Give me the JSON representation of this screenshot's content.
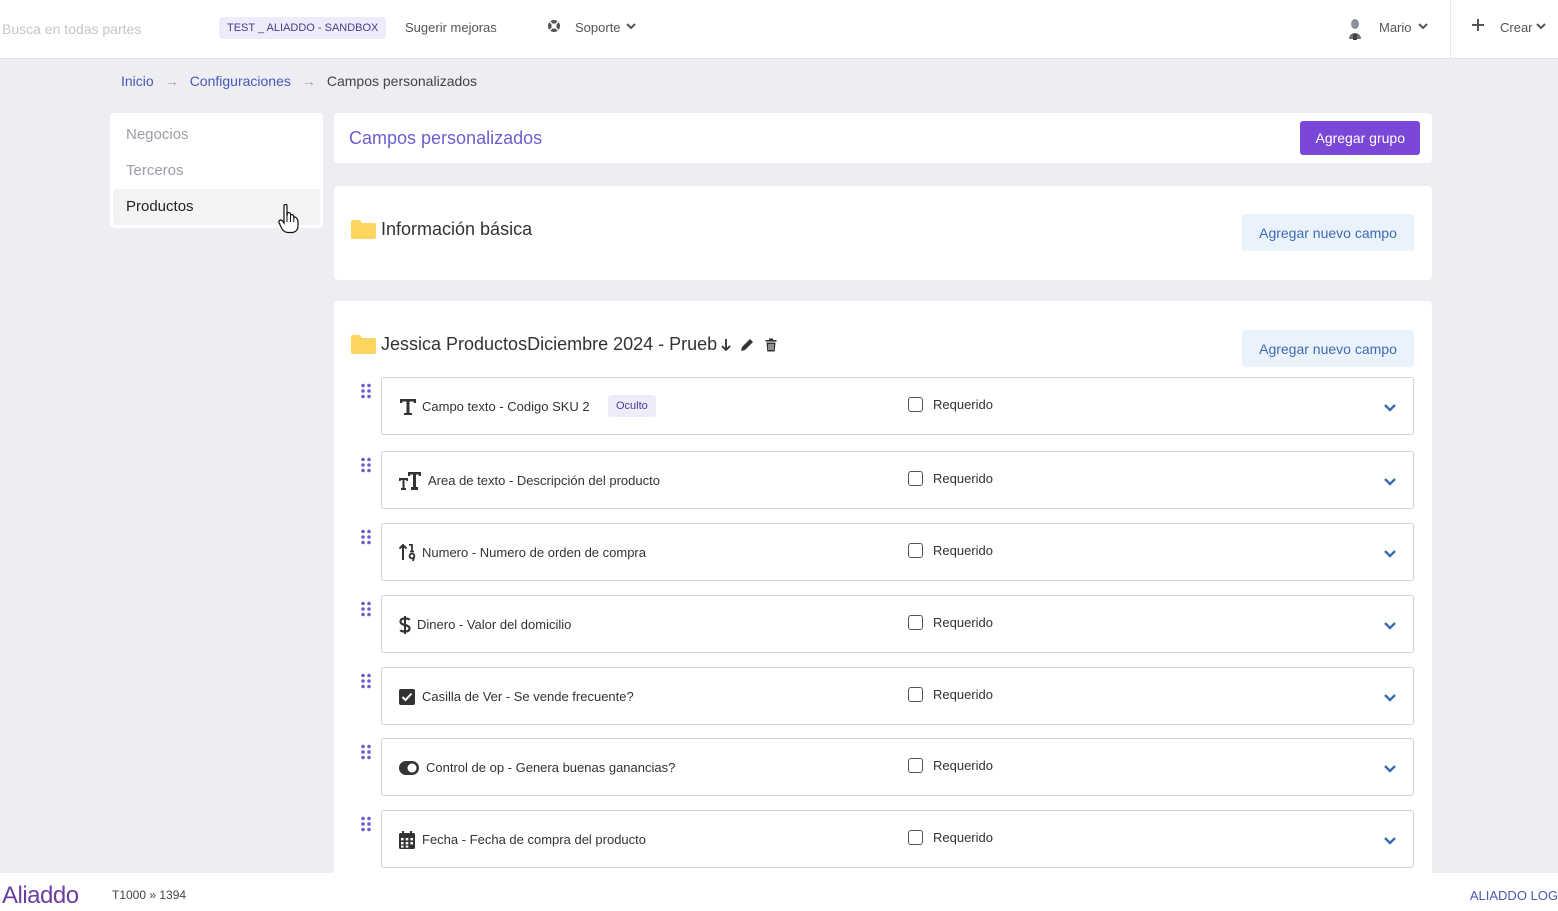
{
  "topbar": {
    "search_placeholder": "Busca en todas partes",
    "env_badge": "TEST _ ALIADDO - SANDBOX",
    "suggest": "Sugerir mejoras",
    "support": "Soporte",
    "user": "Mario",
    "create": "Crear"
  },
  "breadcrumb": {
    "items": [
      "Inicio",
      "Configuraciones",
      "Campos personalizados"
    ]
  },
  "sidebar": {
    "items": [
      {
        "label": "Negocios"
      },
      {
        "label": "Terceros"
      },
      {
        "label": "Productos"
      }
    ]
  },
  "header": {
    "title": "Campos personalizados",
    "add_group": "Agregar grupo"
  },
  "groups": [
    {
      "title": "Información básica",
      "add_field": "Agregar nuevo campo"
    },
    {
      "title": "Jessica ProductosDiciembre 2024 - Prueb",
      "add_field": "Agregar nuevo campo",
      "fields": [
        {
          "icon": "text-icon",
          "label": "Campo texto - Codigo SKU 2",
          "badge": "Oculto",
          "required_label": "Requerido"
        },
        {
          "icon": "text-height-icon",
          "label": "Area de texto - Descripción del producto",
          "required_label": "Requerido"
        },
        {
          "icon": "sort-numeric-icon",
          "label": "Numero - Numero de orden de compra",
          "required_label": "Requerido"
        },
        {
          "icon": "dollar-icon",
          "label": "Dinero - Valor del domicilio",
          "required_label": "Requerido"
        },
        {
          "icon": "checkbox-icon",
          "label": "Casilla de Ver - Se vende frecuente?",
          "required_label": "Requerido"
        },
        {
          "icon": "toggle-icon",
          "label": "Control de op - Genera buenas ganancias?",
          "required_label": "Requerido"
        },
        {
          "icon": "calendar-icon",
          "label": "Fecha - Fecha de compra del producto",
          "required_label": "Requerido"
        }
      ]
    }
  ],
  "footer": {
    "logo": "Aliaddo",
    "ticket": "T1000 » 1394",
    "link": "ALIADDO LOG"
  },
  "colors": {
    "brand": "#7a47d6",
    "link": "#4a58b8",
    "title_accent": "#6b5fd0"
  }
}
